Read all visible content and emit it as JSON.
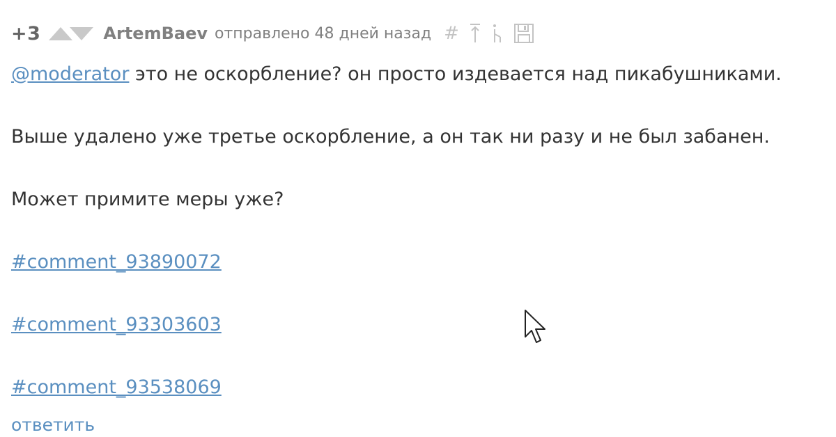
{
  "comment": {
    "score": "+3",
    "author": "ArtemBaev",
    "meta": "отправлено 48 дней назад",
    "icons": [
      "hash-icon",
      "arrow-up-icon",
      "tree-icon",
      "save-icon"
    ],
    "body": {
      "mention": "@moderator",
      "line1_rest": " это не оскорбление? он просто издевается над пикабушниками.",
      "line2": "Выше удалено уже третье оскорбление, а он так ни разу и не был забанен.",
      "line3": "Может примите меры уже?",
      "links": [
        "#comment_93890072",
        "#comment_93303603",
        "#comment_93538069"
      ]
    },
    "reply_label": "ответить"
  },
  "colors": {
    "link": "#5a8fc0",
    "muted": "#808080",
    "vote": "#c9c9c9",
    "text": "#333333"
  }
}
